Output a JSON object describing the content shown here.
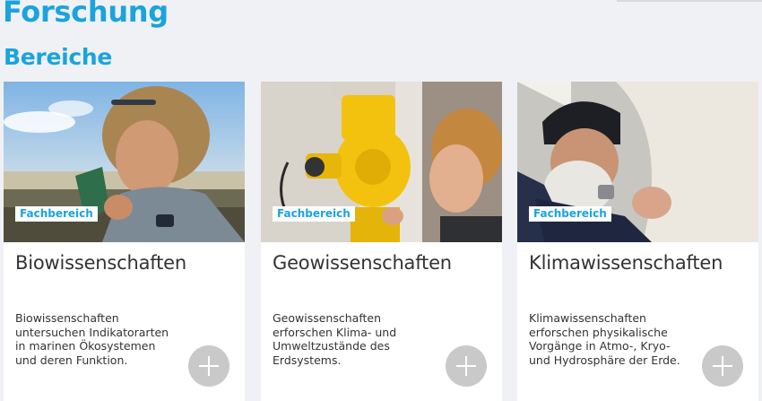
{
  "page": {
    "title": "Forschung"
  },
  "section": {
    "title": "Bereiche"
  },
  "cards": [
    {
      "badge": "Fachbereich",
      "title": "Biowissenschaften",
      "text": "Biowissenschaften untersuchen Indikatorarten in marinen Ökosystemen und deren Funktion.",
      "image": "researcher holding seaweed at the beach"
    },
    {
      "badge": "Fachbereich",
      "title": "Geowissenschaften",
      "text": "Geowissenschaften erforschen Klima- und Umweltzustände des Erdsystems.",
      "image": "researcher looking through yellow surveying instrument"
    },
    {
      "badge": "Fachbereich",
      "title": "Klimawissenschaften",
      "text": "Klimawissenschaften erforschen physikalische Vorgänge in Atmo-, Kryo- und Hydrosphäre der Erde.",
      "image": "bearded researcher in wool hat with balloon"
    }
  ],
  "colors": {
    "accent": "#1ba3dd",
    "button": "#c9c9c9",
    "background": "#f0f1f4"
  }
}
